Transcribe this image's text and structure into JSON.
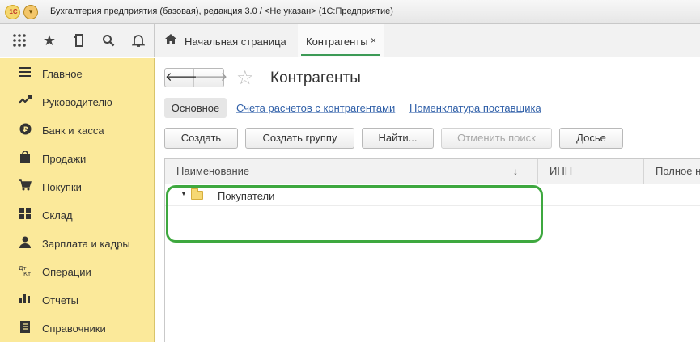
{
  "window": {
    "logo_text": "1С",
    "title": "Бухгалтерия предприятия (базовая), редакция 3.0 / <Не указан>  (1С:Предприятие)"
  },
  "toolbar": {
    "icons": [
      "apps-grid-icon",
      "favorites-star-icon",
      "history-icon",
      "search-icon",
      "notifications-bell-icon"
    ]
  },
  "tabs": [
    {
      "label": "Начальная страница",
      "icon": "home-icon",
      "active": false
    },
    {
      "label": "Контрагенты",
      "active": true,
      "close": "×"
    }
  ],
  "sidebar": {
    "items": [
      {
        "label": "Главное",
        "icon": "≡"
      },
      {
        "label": "Руководителю",
        "icon": "↗"
      },
      {
        "label": "Банк и касса",
        "icon": "₽"
      },
      {
        "label": "Продажи",
        "icon": "▲"
      },
      {
        "label": "Покупки",
        "icon": "🛒"
      },
      {
        "label": "Склад",
        "icon": "▦"
      },
      {
        "label": "Зарплата и кадры",
        "icon": "👤"
      },
      {
        "label": "Операции",
        "icon": "ДтКт"
      },
      {
        "label": "Отчеты",
        "icon": "▮"
      },
      {
        "label": "Справочники",
        "icon": "▤"
      }
    ]
  },
  "page": {
    "title": "Контрагенты",
    "subnav": {
      "active": "Основное",
      "links": [
        "Счета расчетов с контрагентами",
        "Номенклатура поставщика"
      ]
    },
    "buttons": {
      "create": "Создать",
      "create_group": "Создать группу",
      "find": "Найти...",
      "cancel_search": "Отменить поиск",
      "dossier": "Досье"
    }
  },
  "table": {
    "columns": [
      "Наименование",
      "ИНН",
      "Полное наименование"
    ],
    "sort_indicator": "↓",
    "rows": [
      {
        "name": "Покупатели",
        "type": "group",
        "expanded": true
      }
    ]
  },
  "colors": {
    "sidebar_bg": "#fbe99a",
    "active_tab_underline": "#3c9a56",
    "highlight_border": "#3ea83f",
    "link": "#2f5fa8"
  }
}
